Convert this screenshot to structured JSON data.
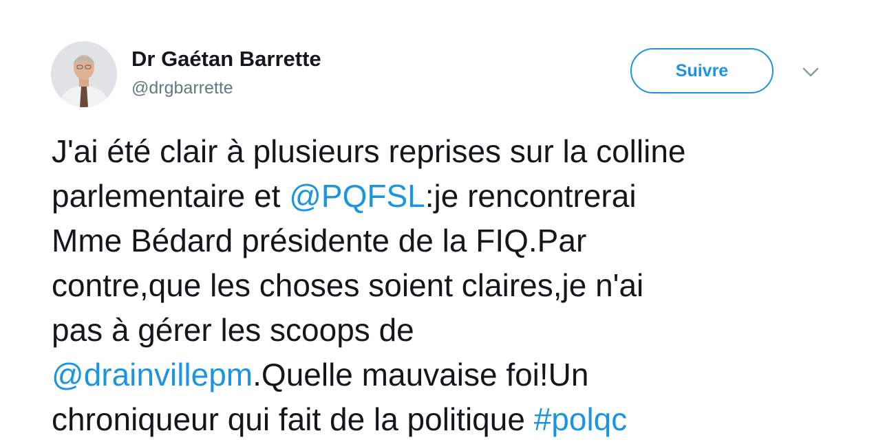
{
  "author": {
    "display_name": "Dr Gaétan Barrette",
    "handle": "@drgbarrette"
  },
  "follow_label": "Suivre",
  "icons": {
    "more": "chevron-down-icon",
    "avatar": "profile-photo"
  },
  "colors": {
    "link": "#1b95e0",
    "text": "#14171a",
    "secondary": "#657786"
  },
  "tweet": {
    "lines": [
      [
        {
          "text": "J'ai été clair à plusieurs reprises sur la colline"
        }
      ],
      [
        {
          "text": "parlementaire et "
        },
        {
          "text": "@PQFSL",
          "link": true
        },
        {
          "text": ":je rencontrerai"
        }
      ],
      [
        {
          "text": "Mme Bédard présidente de la FIQ.Par"
        }
      ],
      [
        {
          "text": "contre,que les choses soient claires,je n'ai"
        }
      ],
      [
        {
          "text": "pas à gérer les scoops de"
        }
      ],
      [
        {
          "text": "@drainvillepm",
          "link": true
        },
        {
          "text": ".Quelle mauvaise foi!Un"
        }
      ],
      [
        {
          "text": "chroniqueur qui fait de la politique "
        },
        {
          "text": "#polqc",
          "link": true
        }
      ]
    ]
  }
}
